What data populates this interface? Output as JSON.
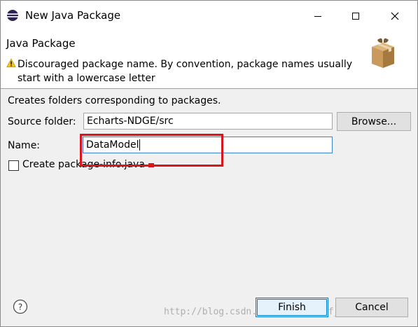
{
  "window": {
    "title": "New Java Package",
    "controls": {
      "minimize": "minimize",
      "maximize": "maximize",
      "close": "close"
    }
  },
  "banner": {
    "title": "Java Package",
    "message": "Discouraged package name. By convention, package names usually start with a lowercase letter",
    "message_icon": "warning-icon",
    "graphic_icon": "package-box-icon"
  },
  "form": {
    "description": "Creates folders corresponding to packages.",
    "source_folder": {
      "label": "Source folder:",
      "value": "Echarts-NDGE/src"
    },
    "browse_button": "Browse...",
    "name": {
      "label": "Name:",
      "value": "DataModel"
    },
    "create_package_info": {
      "label": "Create package-info.java",
      "checked": false
    }
  },
  "footer": {
    "help_icon": "help-icon",
    "finish": "Finish",
    "cancel": "Cancel"
  },
  "watermark": "http://blog.csdn.net/BattleWolf_HUA",
  "colors": {
    "focus_border": "#3c7fd1",
    "default_button_border": "#0078d7",
    "annotation": "#d8161b",
    "warning": "#f0c419"
  }
}
